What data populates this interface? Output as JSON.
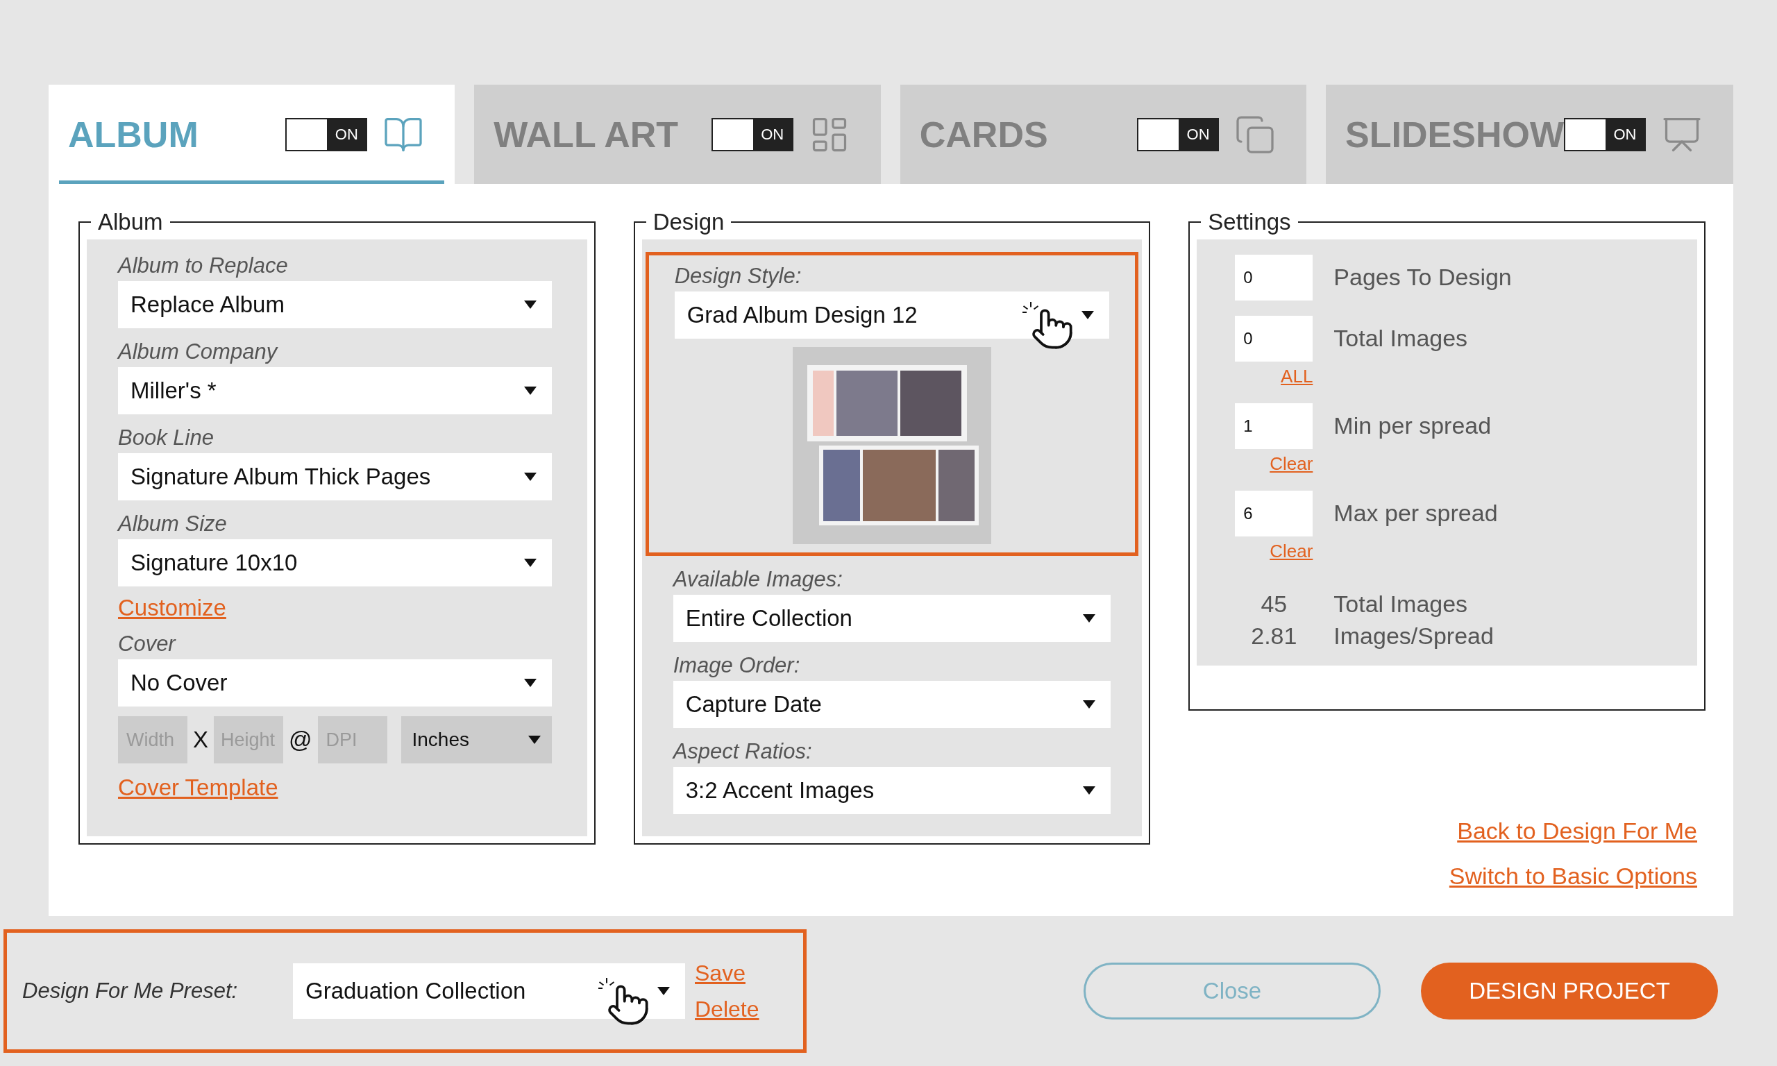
{
  "tabs": [
    {
      "kind": "album",
      "label": "ALBUM",
      "selected": true,
      "toggle": {
        "on": true,
        "label": "ON"
      }
    },
    {
      "kind": "wall_art",
      "label": "WALL ART",
      "selected": false,
      "toggle": {
        "on": true,
        "label": "ON"
      }
    },
    {
      "kind": "cards",
      "label": "CARDS",
      "selected": false,
      "toggle": {
        "on": true,
        "label": "ON"
      }
    },
    {
      "kind": "slideshow",
      "label": "SLIDESHOW",
      "selected": false,
      "toggle": {
        "on": true,
        "label": "ON"
      }
    }
  ],
  "album_group": {
    "title": "Album",
    "fields": [
      {
        "label": "Album to Replace",
        "value": "Replace Album"
      },
      {
        "label": "Album Company",
        "value": "Miller's *"
      },
      {
        "label": "Book Line",
        "value": "Signature Album Thick Pages"
      },
      {
        "label": "Album Size",
        "value": "Signature 10x10"
      }
    ],
    "customize_link": "Customize",
    "cover": {
      "label": "Cover",
      "value": "No Cover"
    },
    "dimensions": {
      "disabled": true,
      "width_placeholder": "Width",
      "times": "X",
      "height_placeholder": "Height",
      "at": "@",
      "dpi_placeholder": "DPI",
      "unit": "Inches"
    },
    "cover_template_link": "Cover Template"
  },
  "design_group": {
    "title": "Design",
    "style": {
      "label": "Design Style:",
      "value": "Grad Album Design 12",
      "highlighted": true
    },
    "fields": [
      {
        "label": "Available Images:",
        "value": "Entire Collection"
      },
      {
        "label": "Image Order:",
        "value": "Capture Date"
      },
      {
        "label": "Aspect Ratios:",
        "value": "3:2 Accent Images"
      }
    ]
  },
  "settings_group": {
    "title": "Settings",
    "rows": [
      {
        "value": "0",
        "label": "Pages To Design"
      },
      {
        "value": "0",
        "label": "Total Images",
        "link": "ALL"
      },
      {
        "value": "1",
        "label": "Min per spread",
        "link": "Clear"
      },
      {
        "value": "6",
        "label": "Max per spread",
        "link": "Clear"
      }
    ],
    "summary": [
      {
        "value": "45",
        "label": "Total Images"
      },
      {
        "value": "2.81",
        "label": "Images/Spread"
      }
    ]
  },
  "links": [
    "Back to Design For Me",
    "Switch to Basic Options"
  ],
  "preset": {
    "label": "Design For Me Preset:",
    "value": "Graduation Collection",
    "highlighted": true,
    "links": [
      "Save",
      "Delete"
    ]
  },
  "buttons": [
    {
      "kind": "secondary",
      "label": "Close"
    },
    {
      "kind": "primary",
      "label": "DESIGN PROJECT"
    }
  ]
}
